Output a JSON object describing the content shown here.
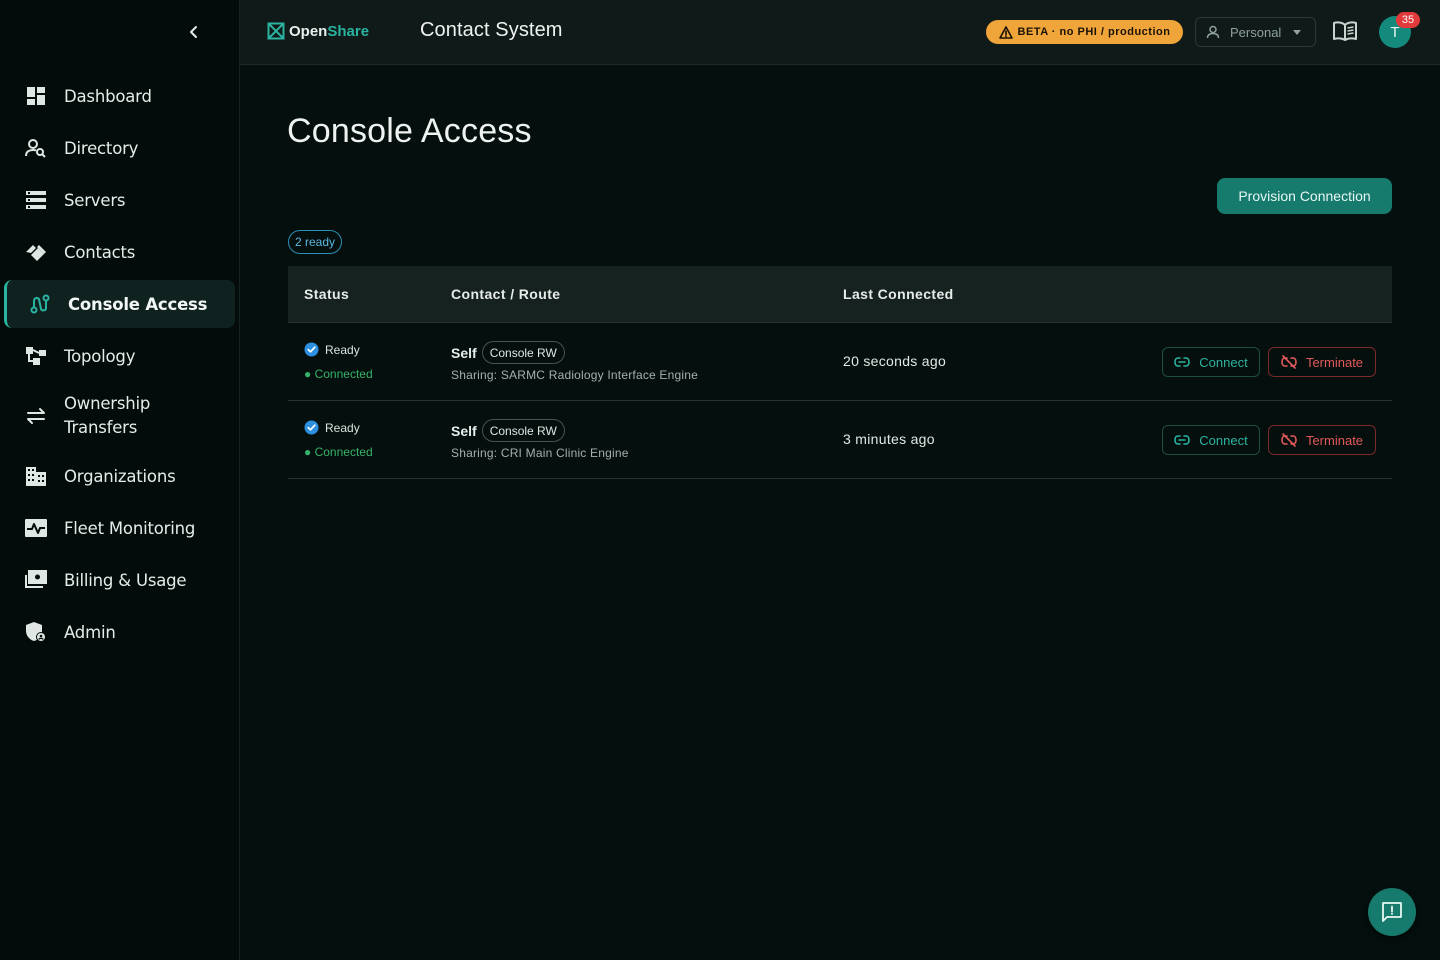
{
  "sidebar": {
    "items": [
      {
        "label": "Dashboard",
        "icon": "dashboard-icon"
      },
      {
        "label": "Directory",
        "icon": "person-search-icon"
      },
      {
        "label": "Servers",
        "icon": "servers-icon"
      },
      {
        "label": "Contacts",
        "icon": "handshake-icon"
      },
      {
        "label": "Console Access",
        "icon": "console-route-icon",
        "active": true
      },
      {
        "label": "Topology",
        "icon": "topology-icon"
      },
      {
        "label": "Ownership Transfers",
        "icon": "transfer-arrows-icon"
      },
      {
        "label": "Organizations",
        "icon": "building-icon"
      },
      {
        "label": "Fleet Monitoring",
        "icon": "monitor-pulse-icon"
      },
      {
        "label": "Billing & Usage",
        "icon": "billing-icon"
      },
      {
        "label": "Admin",
        "icon": "admin-shield-icon"
      }
    ]
  },
  "header": {
    "brand_open": "Open",
    "brand_share": "Share",
    "app_title": "Contact System",
    "beta_label": "BETA · no PHI / production",
    "workspace": "Personal",
    "avatar_initial": "T",
    "notifications": "35"
  },
  "main": {
    "title": "Console Access",
    "provision_label": "Provision Connection",
    "ready_count": "2 ready",
    "columns": {
      "status": "Status",
      "route": "Contact / Route",
      "last": "Last Connected"
    },
    "rows": [
      {
        "status": "Ready",
        "connection": "● Connected",
        "owner": "Self",
        "role": "Console RW",
        "sharing": "Sharing: SARMC Radiology Interface Engine",
        "last_connected": "20 seconds ago",
        "connect_label": "Connect",
        "terminate_label": "Terminate"
      },
      {
        "status": "Ready",
        "connection": "● Connected",
        "owner": "Self",
        "role": "Console RW",
        "sharing": "Sharing: CRI Main Clinic Engine",
        "last_connected": "3 minutes ago",
        "connect_label": "Connect",
        "terminate_label": "Terminate"
      }
    ]
  },
  "colors": {
    "accent": "#2ab3a0",
    "primary_button": "#167a6c",
    "beta_badge": "#f0a53a",
    "danger": "#e35a5a",
    "success": "#36b36a",
    "info": "#5ab7df"
  }
}
